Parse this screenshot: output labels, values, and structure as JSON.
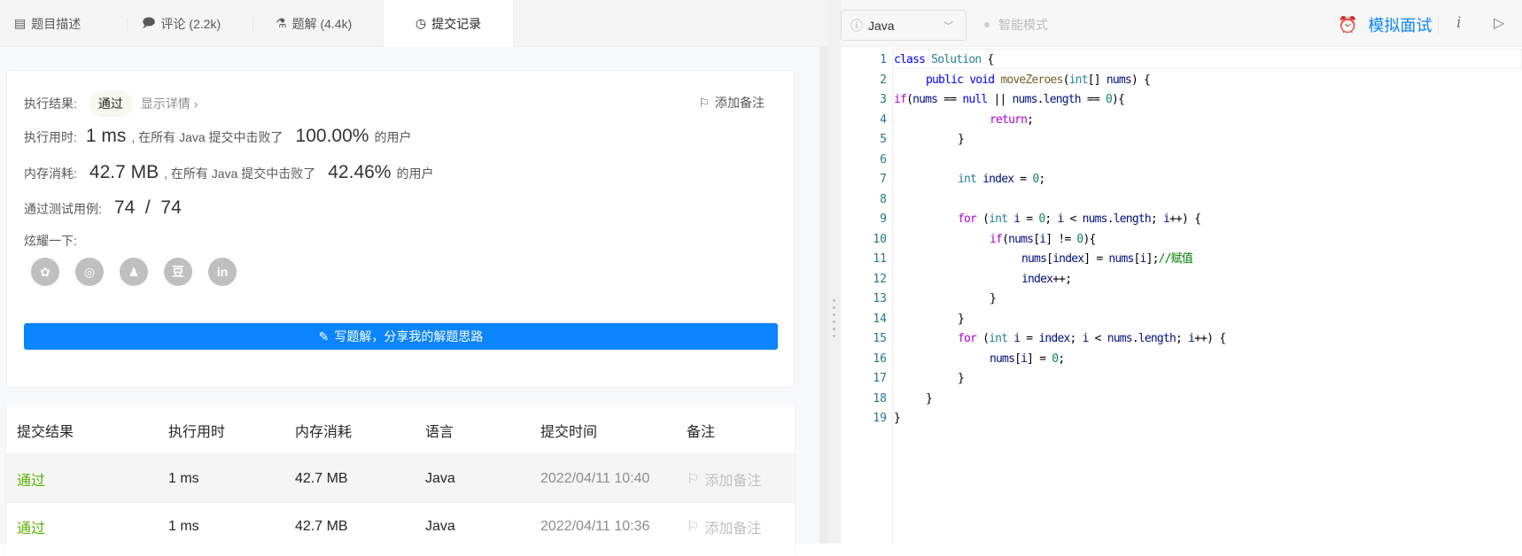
{
  "tabs": [
    {
      "label": "题目描述",
      "icon": "description-icon"
    },
    {
      "label": "评论 (2.2k)",
      "icon": "comment-icon"
    },
    {
      "label": "题解 (4.4k)",
      "icon": "flask-icon"
    },
    {
      "label": "提交记录",
      "icon": "clock-icon",
      "active": true
    }
  ],
  "result": {
    "result_label": "执行结果:",
    "result_value": "通过",
    "show_detail": "显示详情 ›",
    "add_note": "添加备注",
    "runtime_label": "执行用时:",
    "runtime_value": "1 ms",
    "runtime_text": ", 在所有 Java 提交中击败了",
    "runtime_pct": "100.00%",
    "users": "的用户",
    "memory_label": "内存消耗:",
    "memory_value": "42.7 MB",
    "memory_text": ", 在所有 Java 提交中击败了",
    "memory_pct": "42.46%",
    "tests_label": "通过测试用例:",
    "tests_value": "74  /  74",
    "share_label": "炫耀一下:",
    "share_icons": [
      {
        "name": "wechat-icon",
        "glyph": "✿"
      },
      {
        "name": "weibo-icon",
        "glyph": "◎"
      },
      {
        "name": "qq-icon",
        "glyph": "♟"
      },
      {
        "name": "douban-icon",
        "glyph": "豆"
      },
      {
        "name": "linkedin-icon",
        "glyph": "in"
      }
    ],
    "write_button": "写题解，分享我的解题思路"
  },
  "table": {
    "headers": [
      "提交结果",
      "执行用时",
      "内存消耗",
      "语言",
      "提交时间",
      "备注"
    ],
    "rows": [
      {
        "status": "通过",
        "runtime": "1 ms",
        "memory": "42.7 MB",
        "lang": "Java",
        "time": "2022/04/11 10:40",
        "note": "添加备注"
      },
      {
        "status": "通过",
        "runtime": "1 ms",
        "memory": "42.7 MB",
        "lang": "Java",
        "time": "2022/04/11 10:36",
        "note": "添加备注"
      }
    ]
  },
  "editor_bar": {
    "language": "Java",
    "smart_mode": "智能模式",
    "mock_interview": "模拟面试",
    "info": "i"
  },
  "code": [
    [
      [
        "class ",
        "k"
      ],
      [
        "Solution ",
        "t"
      ],
      [
        "{",
        "p"
      ]
    ],
    [
      [
        "\tpublic ",
        "k"
      ],
      [
        "void ",
        "k"
      ],
      [
        "moveZeroes",
        "f"
      ],
      [
        "(",
        "p"
      ],
      [
        "int",
        "t"
      ],
      [
        "[] ",
        "p"
      ],
      [
        "nums",
        "v"
      ],
      [
        ") {",
        "p"
      ]
    ],
    [
      [
        "if",
        "c"
      ],
      [
        "(",
        "p"
      ],
      [
        "nums",
        "v"
      ],
      [
        " == ",
        "p"
      ],
      [
        "null",
        "k"
      ],
      [
        " || ",
        "p"
      ],
      [
        "nums",
        "v"
      ],
      [
        ".",
        "p"
      ],
      [
        "length",
        "v"
      ],
      [
        " == ",
        "p"
      ],
      [
        "0",
        "n"
      ],
      [
        "){",
        "p"
      ]
    ],
    [
      [
        "\t\t\treturn",
        "c"
      ],
      [
        ";",
        "p"
      ]
    ],
    [
      [
        "\t\t}",
        "p"
      ]
    ],
    [
      [
        "",
        "p"
      ]
    ],
    [
      [
        "\t\tint ",
        "t"
      ],
      [
        "index",
        "v"
      ],
      [
        " = ",
        "p"
      ],
      [
        "0",
        "n"
      ],
      [
        ";",
        "p"
      ]
    ],
    [
      [
        "",
        "p"
      ]
    ],
    [
      [
        "\t\tfor ",
        "c"
      ],
      [
        "(",
        "p"
      ],
      [
        "int ",
        "t"
      ],
      [
        "i",
        "v"
      ],
      [
        " = ",
        "p"
      ],
      [
        "0",
        "n"
      ],
      [
        "; ",
        "p"
      ],
      [
        "i",
        "v"
      ],
      [
        " < ",
        "p"
      ],
      [
        "nums",
        "v"
      ],
      [
        ".",
        "p"
      ],
      [
        "length",
        "v"
      ],
      [
        "; ",
        "p"
      ],
      [
        "i",
        "v"
      ],
      [
        "++) {",
        "p"
      ]
    ],
    [
      [
        "\t\t\tif",
        "c"
      ],
      [
        "(",
        "p"
      ],
      [
        "nums",
        "v"
      ],
      [
        "[",
        "p"
      ],
      [
        "i",
        "v"
      ],
      [
        "] != ",
        "p"
      ],
      [
        "0",
        "n"
      ],
      [
        "){",
        "p"
      ]
    ],
    [
      [
        "\t\t\t\tnums",
        "v"
      ],
      [
        "[",
        "p"
      ],
      [
        "index",
        "v"
      ],
      [
        "] = ",
        "p"
      ],
      [
        "nums",
        "v"
      ],
      [
        "[",
        "p"
      ],
      [
        "i",
        "v"
      ],
      [
        "];",
        "p"
      ],
      [
        "//赋值",
        "g"
      ]
    ],
    [
      [
        "\t\t\t\tindex",
        "v"
      ],
      [
        "++;",
        "p"
      ]
    ],
    [
      [
        "\t\t\t}",
        "p"
      ]
    ],
    [
      [
        "\t\t}",
        "p"
      ]
    ],
    [
      [
        "\t\tfor ",
        "c"
      ],
      [
        "(",
        "p"
      ],
      [
        "int ",
        "t"
      ],
      [
        "i",
        "v"
      ],
      [
        " = ",
        "p"
      ],
      [
        "index",
        "v"
      ],
      [
        "; ",
        "p"
      ],
      [
        "i",
        "v"
      ],
      [
        " < ",
        "p"
      ],
      [
        "nums",
        "v"
      ],
      [
        ".",
        "p"
      ],
      [
        "length",
        "v"
      ],
      [
        "; ",
        "p"
      ],
      [
        "i",
        "v"
      ],
      [
        "++) {",
        "p"
      ]
    ],
    [
      [
        "\t\t\tnums",
        "v"
      ],
      [
        "[",
        "p"
      ],
      [
        "i",
        "v"
      ],
      [
        "] = ",
        "p"
      ],
      [
        "0",
        "n"
      ],
      [
        ";",
        "p"
      ]
    ],
    [
      [
        "\t\t}",
        "p"
      ]
    ],
    [
      [
        "\t}",
        "p"
      ]
    ],
    [
      [
        "}",
        "p"
      ]
    ]
  ]
}
